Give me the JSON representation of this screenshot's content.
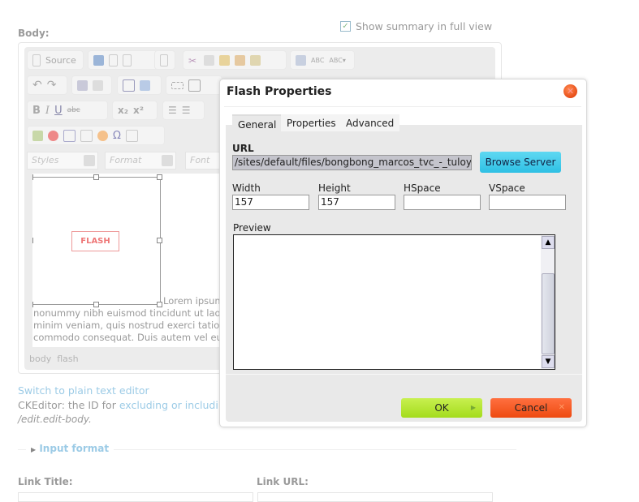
{
  "body_label": "Body:",
  "show_summary": {
    "label": "Show summary in full view",
    "checked": true
  },
  "toolbar": {
    "source": "Source",
    "styles": "Styles",
    "format": "Format",
    "font": "Font",
    "bold": "B",
    "italic": "I",
    "underline": "U",
    "strike": "abc",
    "subscript": "x₂",
    "superscript": "x²",
    "spell1": "ABC",
    "spell2": "ABC▾"
  },
  "flash_placeholder": "FLASH",
  "content_lines": [
    "Lorem ipsum",
    "nonummy nibh euismod tincidunt ut laoreet",
    "minim veniam, quis nostrud exerci tation u",
    "commodo consequat. Duis autem vel eum"
  ],
  "status_path": [
    "body",
    "flash"
  ],
  "switch_link": "Switch to plain text editor",
  "ck_note": {
    "prefix": "CKEditor: the ID for ",
    "link": "excluding or includi",
    "path": "/edit.edit-body",
    "suffix": "."
  },
  "input_format": "Input format",
  "link_title": "Link Title:",
  "link_url": "Link URL:",
  "dialog": {
    "title": "Flash Properties",
    "tabs": [
      "General",
      "Properties",
      "Advanced"
    ],
    "url_label": "URL",
    "url_value": "/sites/default/files/bongbong_marcos_tvc_-_tuloy_tuloy",
    "browse": "Browse Server",
    "width_label": "Width",
    "width_value": "157",
    "height_label": "Height",
    "height_value": "157",
    "hspace_label": "HSpace",
    "hspace_value": "",
    "vspace_label": "VSpace",
    "vspace_value": "",
    "preview_label": "Preview",
    "ok": "OK",
    "cancel": "Cancel"
  }
}
